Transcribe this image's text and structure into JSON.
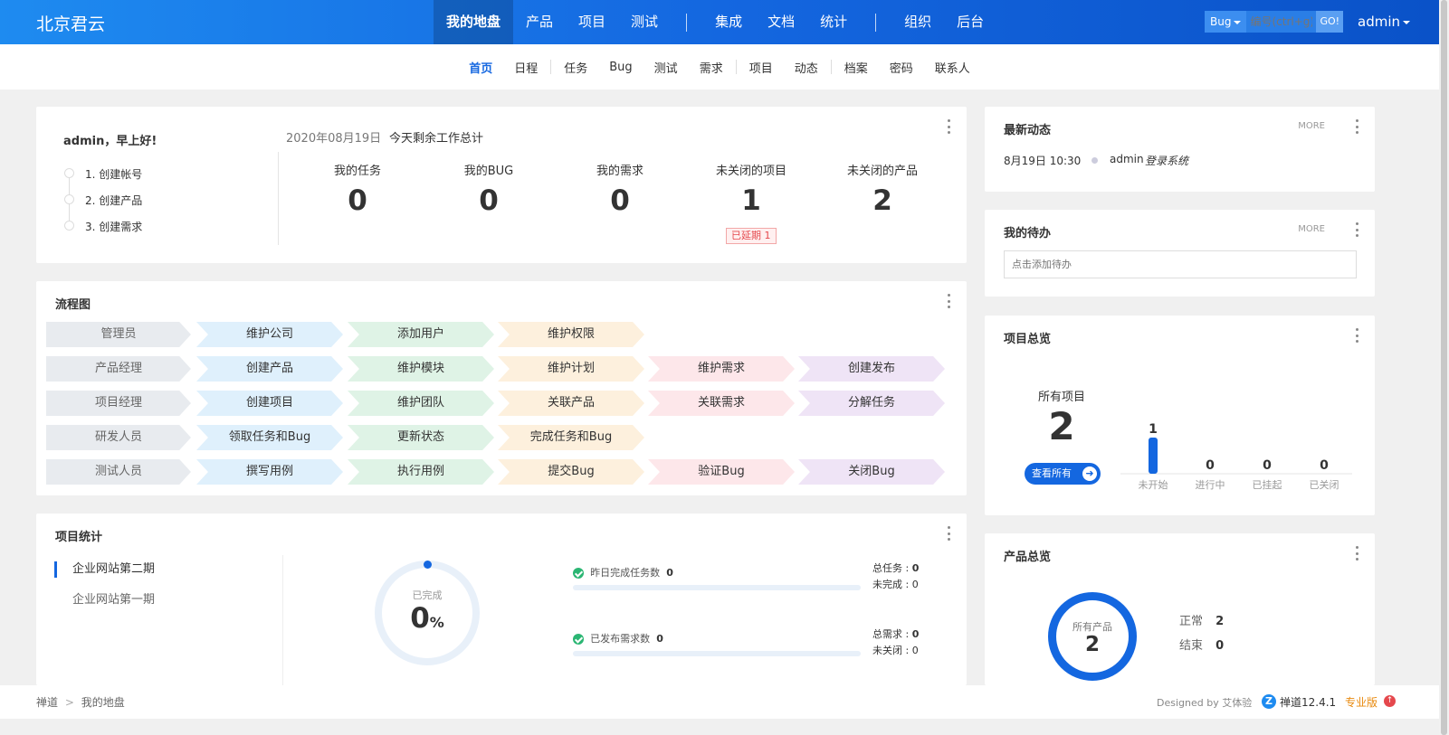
{
  "header": {
    "brand": "北京君云",
    "nav": [
      "我的地盘",
      "产品",
      "项目",
      "测试",
      "集成",
      "文档",
      "统计",
      "组织",
      "后台"
    ],
    "search": {
      "type": "Bug",
      "placeholder": "编号(ctrl+g)",
      "go": "GO!"
    },
    "user": "admin"
  },
  "subnav": [
    "首页",
    "日程",
    "任务",
    "Bug",
    "测试",
    "需求",
    "项目",
    "动态",
    "档案",
    "密码",
    "联系人"
  ],
  "welcome": {
    "greeting": "admin，早上好!",
    "steps": [
      "1. 创建帐号",
      "2. 创建产品",
      "3. 创建需求"
    ],
    "date": "2020年08月19日",
    "summary_label": "今天剩余工作总计",
    "stats": [
      {
        "label": "我的任务",
        "value": "0"
      },
      {
        "label": "我的BUG",
        "value": "0"
      },
      {
        "label": "我的需求",
        "value": "0"
      },
      {
        "label": "未关闭的项目",
        "value": "1"
      },
      {
        "label": "未关闭的产品",
        "value": "2"
      }
    ],
    "delayed": "已延期 1"
  },
  "flow": {
    "title": "流程图",
    "rows": [
      [
        "管理员",
        "维护公司",
        "添加用户",
        "维护权限"
      ],
      [
        "产品经理",
        "创建产品",
        "维护模块",
        "维护计划",
        "维护需求",
        "创建发布"
      ],
      [
        "项目经理",
        "创建项目",
        "维护团队",
        "关联产品",
        "关联需求",
        "分解任务"
      ],
      [
        "研发人员",
        "领取任务和Bug",
        "更新状态",
        "完成任务和Bug"
      ],
      [
        "测试人员",
        "撰写用例",
        "执行用例",
        "提交Bug",
        "验证Bug",
        "关闭Bug"
      ]
    ]
  },
  "project_stats": {
    "title": "项目统计",
    "projects": [
      "企业网站第二期",
      "企业网站第一期"
    ],
    "completed_label": "已完成",
    "completed_value": "0",
    "completed_unit": "%",
    "completed_percent": 0,
    "row1": {
      "label": "昨日完成任务数",
      "value": "0",
      "total_label": "总任务",
      "total": "0",
      "unfinished_label": "未完成",
      "unfinished": "0"
    },
    "row2": {
      "label": "已发布需求数",
      "value": "0",
      "total_label": "总需求",
      "total": "0",
      "unclosed_label": "未关闭",
      "unclosed": "0"
    }
  },
  "latest": {
    "title": "最新动态",
    "more": "MORE",
    "items": [
      {
        "time": "8月19日 10:30",
        "user": "admin",
        "action": "登录系统"
      }
    ]
  },
  "todo": {
    "title": "我的待办",
    "more": "MORE",
    "placeholder": "点击添加待办"
  },
  "project_overview": {
    "title": "项目总览",
    "all_label": "所有项目",
    "all_value": "2",
    "view_all": "查看所有",
    "chart_data": {
      "type": "bar",
      "categories": [
        "未开始",
        "进行中",
        "已挂起",
        "已关闭"
      ],
      "values": [
        1,
        0,
        0,
        0
      ]
    }
  },
  "product_overview": {
    "title": "产品总览",
    "ring_label": "所有产品",
    "ring_value": "2",
    "normal_label": "正常",
    "normal_value": "2",
    "ended_label": "结束",
    "ended_value": "0"
  },
  "footer": {
    "breadcrumb": [
      "禅道",
      "我的地盘"
    ],
    "designed_by": "Designed by 艾体验",
    "version": "禅道12.4.1",
    "edition": "专业版"
  },
  "colors": {
    "primary": "#1467e0",
    "green": "#2bb673",
    "danger": "#e5484d"
  }
}
